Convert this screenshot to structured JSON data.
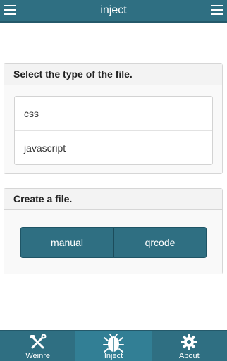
{
  "header": {
    "title": "inject",
    "left_icon": "hamburger-menu-icon",
    "right_icon": "hamburger-menu-icon"
  },
  "type_panel": {
    "title": "Select the type of the file.",
    "items": [
      {
        "label": "css"
      },
      {
        "label": "javascript"
      }
    ]
  },
  "create_panel": {
    "title": "Create a file.",
    "buttons": [
      {
        "label": "manual"
      },
      {
        "label": "qrcode"
      }
    ]
  },
  "bottom_nav": {
    "items": [
      {
        "label": "Weinre",
        "icon": "tools-icon",
        "active": false
      },
      {
        "label": "Inject",
        "icon": "bug-icon",
        "active": true
      },
      {
        "label": "About",
        "icon": "gear-icon",
        "active": false
      }
    ]
  },
  "colors": {
    "primary": "#2f6f82",
    "panel_bg": "#f5f5f5",
    "border": "#d6d6d6"
  }
}
